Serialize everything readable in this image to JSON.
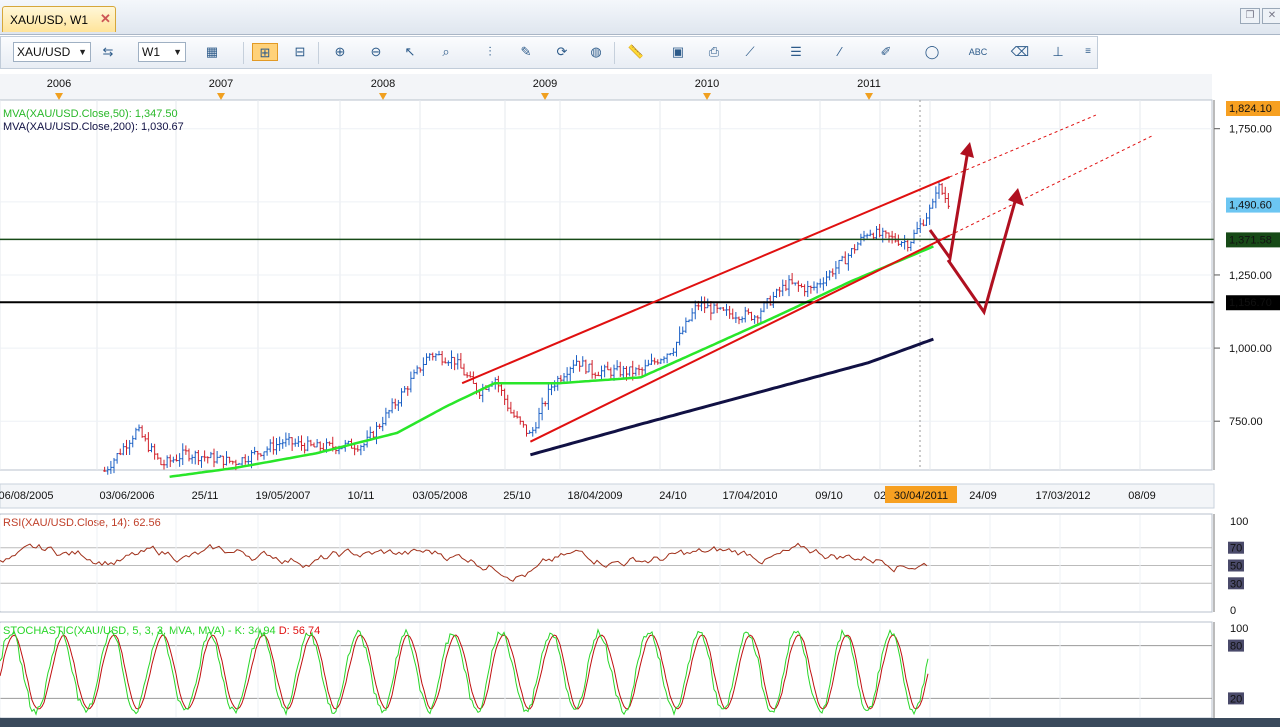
{
  "window": {
    "tab_title": "XAU/USD, W1",
    "close_glyph": "✕"
  },
  "toolbar": {
    "symbol": "XAU/USD",
    "timeframe": "W1",
    "icons": [
      "chart-type-icon",
      "indicator-icon",
      "period-icon",
      "bar-chart-icon",
      "table-icon",
      "zoom-in-icon",
      "zoom-out-icon",
      "cursor-icon",
      "search-icon",
      "vertical-line-icon",
      "edit-icon",
      "refresh-icon",
      "globe-icon",
      "ruler-icon",
      "image-icon",
      "print-icon",
      "fibonacci-icon",
      "channel-icon",
      "trendline-icon",
      "pen-icon",
      "ellipse-icon",
      "text-icon",
      "eraser-icon",
      "tree-icon"
    ]
  },
  "chart_data": [
    {
      "type": "line",
      "name": "main",
      "timeline_years": [
        "2006",
        "2007",
        "2008",
        "2009",
        "2010",
        "2011"
      ],
      "x_tick_labels": [
        "06/08/2005",
        "03/06/2006",
        "25/11",
        "19/05/2007",
        "10/11",
        "03/05/2008",
        "25/10",
        "18/04/2009",
        "24/10",
        "17/04/2010",
        "09/10",
        "02",
        "30/04/2011",
        "24/09",
        "17/03/2012",
        "08/09"
      ],
      "y_tick_labels": [
        "1,750.00",
        "1,250.00",
        "1,000.00",
        "750.00"
      ],
      "price_tags": [
        {
          "label": "1,824.10",
          "value": 1824.1,
          "color": "#f7a021"
        },
        {
          "label": "1,490.60",
          "value": 1490.6,
          "color": "#6cc6f2"
        },
        {
          "label": "1,371.58",
          "value": 1371.58,
          "color": "#174a17"
        },
        {
          "label": "1,156.70",
          "value": 1156.7,
          "color": "#000000"
        }
      ],
      "horizontal_lines": [
        1371.58,
        1156.7
      ],
      "series": [
        {
          "name": "MVA(XAU/USD.Close,50)",
          "last_value": "1,347.50",
          "color": "#29d629"
        },
        {
          "name": "MVA(XAU/USD.Close,200)",
          "last_value": "1,030.67",
          "color": "#111144"
        }
      ],
      "ma50_points": [
        [
          2006.6,
          560
        ],
        [
          2007.0,
          590
        ],
        [
          2007.5,
          640
        ],
        [
          2008.0,
          710
        ],
        [
          2008.3,
          800
        ],
        [
          2008.6,
          880
        ],
        [
          2009.0,
          880
        ],
        [
          2009.5,
          900
        ],
        [
          2009.9,
          1000
        ],
        [
          2010.3,
          1100
        ],
        [
          2010.8,
          1230
        ],
        [
          2011.3,
          1347.5
        ]
      ],
      "ma200_points": [
        [
          2008.82,
          635
        ],
        [
          2009.5,
          740
        ],
        [
          2010.3,
          860
        ],
        [
          2010.9,
          950
        ],
        [
          2011.3,
          1030.67
        ]
      ],
      "channel": {
        "upper": [
          [
            2008.4,
            880
          ],
          [
            2011.4,
            1585
          ]
        ],
        "lower": [
          [
            2008.82,
            680
          ],
          [
            2011.4,
            1385
          ]
        ],
        "color": "#e01010"
      },
      "forecast_arrows": [
        "up",
        "down-then-up"
      ],
      "current_date_label": "30/04/2011",
      "ylim": [
        590,
        1850
      ]
    },
    {
      "type": "line",
      "name": "rsi",
      "title": "RSI(XAU/USD.Close, 14): 62.56",
      "y_tick_labels": [
        "100",
        "70",
        "50",
        "30",
        "0"
      ],
      "levels": [
        70,
        50,
        30
      ],
      "ylim": [
        0,
        100
      ]
    },
    {
      "type": "line",
      "name": "stochastic",
      "title_prefix": "STOCHASTIC(XAU/USD, 5, 3, 3, MVA, MVA) - K:",
      "k_value": "34.94",
      "d_label": "D: 56.74",
      "y_tick_labels": [
        "100",
        "80",
        "20"
      ],
      "levels": [
        80,
        20
      ],
      "ylim": [
        0,
        100
      ]
    }
  ]
}
